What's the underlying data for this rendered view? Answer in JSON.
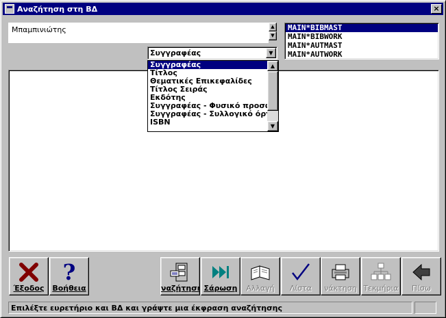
{
  "window": {
    "title": "Αναζήτηση στη ΒΔ",
    "close": "×"
  },
  "search": {
    "value": "Μπαμπινιώτης"
  },
  "databases": [
    "MAIN*BIBMAST",
    "MAIN*BIBWORK",
    "MAIN*AUTMAST",
    "MAIN*AUTWORK"
  ],
  "selected_database": "MAIN*BIBMAST",
  "index_combo": {
    "value": "Συγγραφέας"
  },
  "index_options": [
    "Συγγραφέας",
    "Τίτλος",
    "Θεματικές Επικεφαλίδες",
    "Τίτλος Σειράς",
    "Εκδότης",
    "Συγγραφέας - Φυσικό προσω",
    "Συγγραφέας - Συλλογικό όργα",
    "ISBN"
  ],
  "buttons": {
    "exit": "Έξοδος",
    "help": "Βοήθεια",
    "search": "ναζήτηση",
    "scan": "Σάρωση",
    "change": "Αλλαγή",
    "list": "Λίστα",
    "recall": "νάκτηση",
    "items": "Τεκμήρια",
    "back": "Πίσω"
  },
  "status": {
    "message": "Επιλέξτε ευρετήριο και ΒΔ και γράψτε μια έκφραση αναζήτησης"
  },
  "colors": {
    "titlebar": "#000080",
    "face": "#c0c0c0",
    "exit_icon": "#800000",
    "help_icon": "#000080"
  }
}
